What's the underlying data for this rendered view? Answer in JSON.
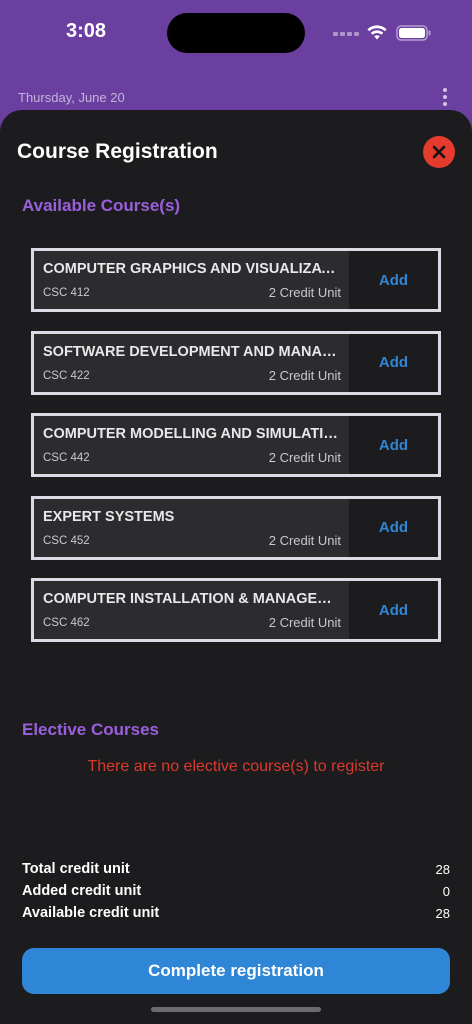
{
  "status_bar": {
    "time": "3:08"
  },
  "header": {
    "date": "Thursday, June 20"
  },
  "sheet": {
    "title": "Course Registration",
    "available_heading": "Available Course(s)",
    "courses": [
      {
        "name": "COMPUTER GRAPHICS AND VISUALIZATION",
        "code": "CSC 412",
        "credit": "2 Credit Unit",
        "action": "Add"
      },
      {
        "name": "SOFTWARE DEVELOPMENT AND MANAGEMENT",
        "code": "CSC 422",
        "credit": "2 Credit Unit",
        "action": "Add"
      },
      {
        "name": "COMPUTER MODELLING AND SIMULATION",
        "code": "CSC 442",
        "credit": "2 Credit Unit",
        "action": "Add"
      },
      {
        "name": "EXPERT SYSTEMS",
        "code": "CSC 452",
        "credit": "2 Credit Unit",
        "action": "Add"
      },
      {
        "name": "COMPUTER INSTALLATION & MANAGEMENT",
        "code": "CSC 462",
        "credit": "2 Credit Unit",
        "action": "Add"
      }
    ],
    "elective_heading": "Elective Courses",
    "no_elective_message": "There are no elective course(s) to register",
    "summary": [
      {
        "label": "Total credit unit",
        "value": "28"
      },
      {
        "label": "Added credit unit",
        "value": "0"
      },
      {
        "label": "Available credit unit",
        "value": "28"
      }
    ],
    "complete_button": "Complete registration"
  },
  "colors": {
    "accent": "#2f86d6",
    "heading": "#9a5fdc",
    "error": "#d93a2e",
    "close": "#e53b2f",
    "background": "#1c1c1e"
  }
}
